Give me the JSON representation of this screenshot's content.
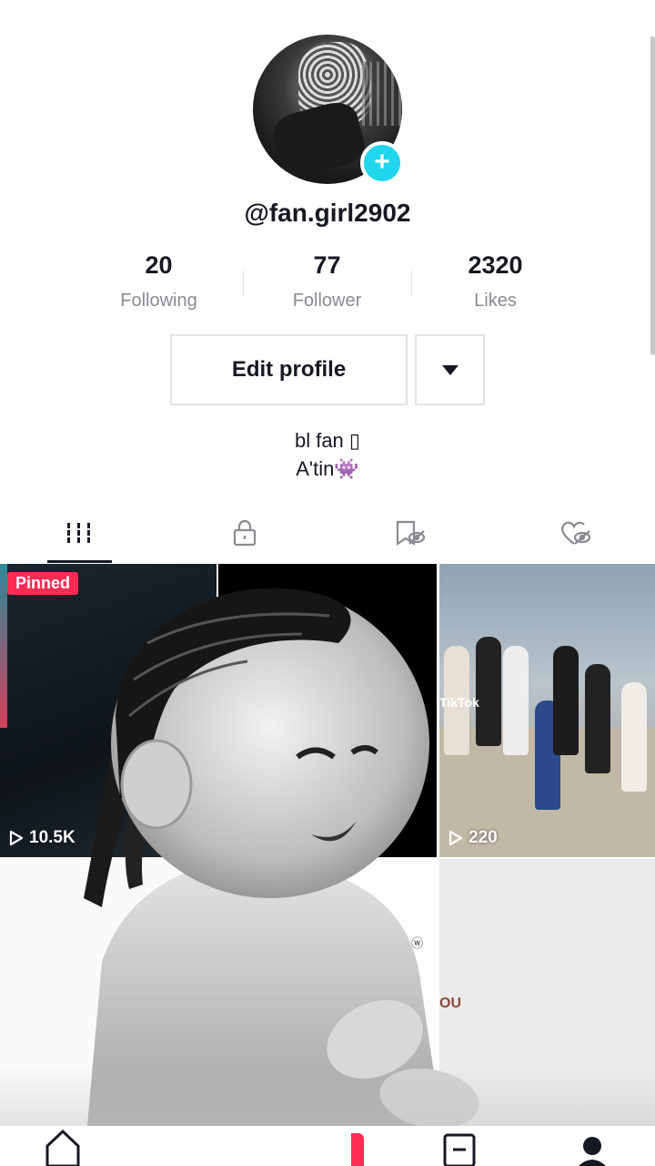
{
  "profile": {
    "username": "@fan.girl2902",
    "avatar_badge": "+",
    "stats": [
      {
        "value": "20",
        "label": "Following"
      },
      {
        "value": "77",
        "label": "Follower"
      },
      {
        "value": "2320",
        "label": "Likes"
      }
    ],
    "edit_button_label": "Edit profile",
    "bio_line1": "bl fan ▯",
    "bio_line2": "A'tin",
    "bio_emoji": "👾"
  },
  "tabs": [
    {
      "name": "videos",
      "icon": "grid-icon",
      "active": true
    },
    {
      "name": "private",
      "icon": "lock-icon",
      "active": false
    },
    {
      "name": "favorites",
      "icon": "bookmark-hidden-icon",
      "active": false
    },
    {
      "name": "liked",
      "icon": "heart-hidden-icon",
      "active": false
    }
  ],
  "videos": [
    {
      "pinned_label": "Pinned",
      "views": "10.5K"
    },
    {
      "views": ""
    },
    {
      "views": "220",
      "watermark": "TikTok"
    },
    {
      "views": ""
    },
    {
      "views": ""
    },
    {
      "views": "",
      "overlay_text": "OU"
    }
  ],
  "nav": [
    {
      "name": "home",
      "icon": "home-icon"
    },
    {
      "name": "create",
      "icon": "plus-icon"
    },
    {
      "name": "inbox",
      "icon": "inbox-icon"
    },
    {
      "name": "profile",
      "icon": "profile-icon"
    }
  ],
  "colors": {
    "accent_red": "#fe2c55",
    "accent_cyan": "#20d5ec",
    "text_primary": "#161823",
    "text_secondary": "#8a8b91"
  }
}
